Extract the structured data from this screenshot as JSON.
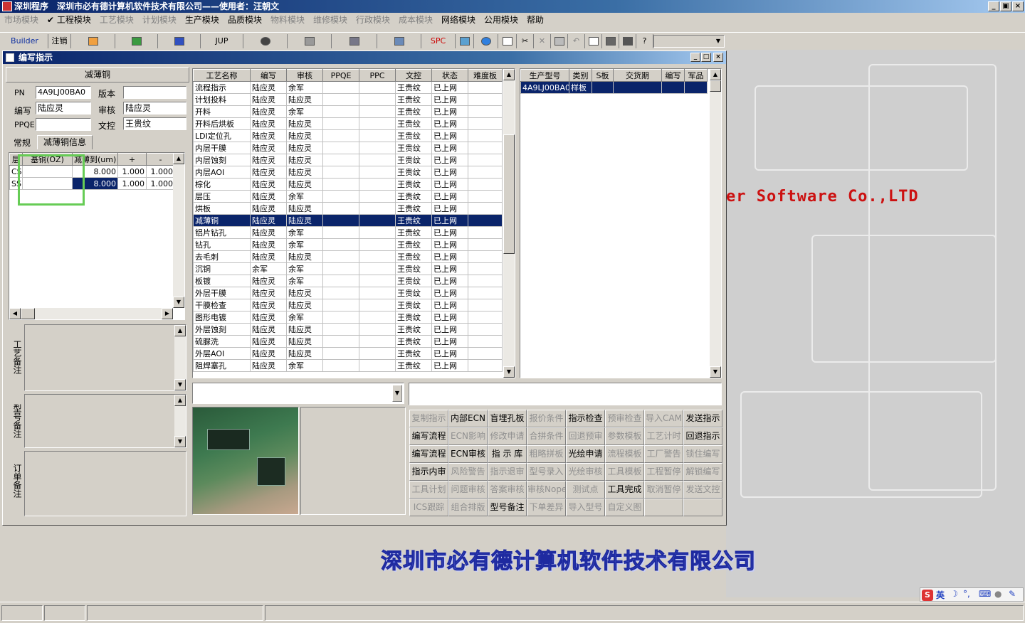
{
  "app": {
    "title": "深圳程序　深圳市必有德计算机软件技术有限公司——使用者：汪朝文",
    "minimize": "_",
    "restore": "▣",
    "close": "×"
  },
  "menu": [
    {
      "label": "市场模块",
      "enabled": false
    },
    {
      "label": "✔ 工程模块",
      "enabled": true
    },
    {
      "label": "工艺模块",
      "enabled": false
    },
    {
      "label": "计划模块",
      "enabled": false
    },
    {
      "label": "生产模块",
      "enabled": true
    },
    {
      "label": "品质模块",
      "enabled": true
    },
    {
      "label": "物料模块",
      "enabled": false
    },
    {
      "label": "维修模块",
      "enabled": false
    },
    {
      "label": "行政模块",
      "enabled": false
    },
    {
      "label": "成本模块",
      "enabled": false
    },
    {
      "label": "网络模块",
      "enabled": true
    },
    {
      "label": "公用模块",
      "enabled": true
    },
    {
      "label": "帮助",
      "enabled": true
    }
  ],
  "toolbar": {
    "builder": "Builder",
    "logout": "注销",
    "jup": "JUP",
    "spc": "SPC"
  },
  "background": {
    "company_en": "er Software Co.,LTD",
    "company_cn": "深圳市必有德计算机软件技术有限公司"
  },
  "window": {
    "title": "编写指示"
  },
  "left": {
    "header": "减薄铜",
    "pn_label": "PN",
    "pn_value": "4A9LJ00BA0",
    "version_label": "版本",
    "version_value": "",
    "writer_label": "编写",
    "writer_value": "陆应灵",
    "review_label": "审核",
    "review_value": "陆应灵",
    "ppqe_label": "PPQE",
    "ppqe_value": "",
    "docctl_label": "文控",
    "docctl_value": "王贵纹",
    "tabs": [
      "常规",
      "减薄铜信息"
    ],
    "thin_table": {
      "headers": [
        "层",
        "基铜(OZ)",
        "减薄到(um)",
        "+",
        "-"
      ],
      "rows": [
        [
          "CS",
          "",
          "8.000",
          "1.000",
          "1.000"
        ],
        [
          "SS",
          "",
          "8.000",
          "1.000",
          "1.000"
        ]
      ]
    },
    "remark_labels": [
      "工艺备注",
      "型号备注",
      "订单备注"
    ]
  },
  "process": {
    "headers": [
      "工艺名称",
      "编写",
      "审核",
      "PPQE",
      "PPC",
      "文控",
      "状态",
      "难度板"
    ],
    "rows": [
      [
        "流程指示",
        "陆应灵",
        "余军",
        "",
        "",
        "王贵纹",
        "已上网",
        ""
      ],
      [
        "计划投料",
        "陆应灵",
        "陆应灵",
        "",
        "",
        "王贵纹",
        "已上网",
        ""
      ],
      [
        "开料",
        "陆应灵",
        "余军",
        "",
        "",
        "王贵纹",
        "已上网",
        ""
      ],
      [
        "开料后烘板",
        "陆应灵",
        "陆应灵",
        "",
        "",
        "王贵纹",
        "已上网",
        ""
      ],
      [
        "LDI定位孔",
        "陆应灵",
        "陆应灵",
        "",
        "",
        "王贵纹",
        "已上网",
        ""
      ],
      [
        "内层干膜",
        "陆应灵",
        "陆应灵",
        "",
        "",
        "王贵纹",
        "已上网",
        ""
      ],
      [
        "内层蚀刻",
        "陆应灵",
        "陆应灵",
        "",
        "",
        "王贵纹",
        "已上网",
        ""
      ],
      [
        "内层AOI",
        "陆应灵",
        "陆应灵",
        "",
        "",
        "王贵纹",
        "已上网",
        ""
      ],
      [
        "棕化",
        "陆应灵",
        "陆应灵",
        "",
        "",
        "王贵纹",
        "已上网",
        ""
      ],
      [
        "层压",
        "陆应灵",
        "余军",
        "",
        "",
        "王贵纹",
        "已上网",
        ""
      ],
      [
        "烘板",
        "陆应灵",
        "陆应灵",
        "",
        "",
        "王贵纹",
        "已上网",
        ""
      ],
      [
        "减薄铜",
        "陆应灵",
        "陆应灵",
        "",
        "",
        "王贵纹",
        "已上网",
        ""
      ],
      [
        "铝片钻孔",
        "陆应灵",
        "余军",
        "",
        "",
        "王贵纹",
        "已上网",
        ""
      ],
      [
        "钻孔",
        "陆应灵",
        "余军",
        "",
        "",
        "王贵纹",
        "已上网",
        ""
      ],
      [
        "去毛刺",
        "陆应灵",
        "陆应灵",
        "",
        "",
        "王贵纹",
        "已上网",
        ""
      ],
      [
        "沉铜",
        "余军",
        "余军",
        "",
        "",
        "王贵纹",
        "已上网",
        ""
      ],
      [
        "板镀",
        "陆应灵",
        "余军",
        "",
        "",
        "王贵纹",
        "已上网",
        ""
      ],
      [
        "外层干膜",
        "陆应灵",
        "陆应灵",
        "",
        "",
        "王贵纹",
        "已上网",
        ""
      ],
      [
        "干膜检查",
        "陆应灵",
        "陆应灵",
        "",
        "",
        "王贵纹",
        "已上网",
        ""
      ],
      [
        "图形电镀",
        "陆应灵",
        "余军",
        "",
        "",
        "王贵纹",
        "已上网",
        ""
      ],
      [
        "外层蚀刻",
        "陆应灵",
        "陆应灵",
        "",
        "",
        "王贵纹",
        "已上网",
        ""
      ],
      [
        "硫脲洗",
        "陆应灵",
        "陆应灵",
        "",
        "",
        "王贵纹",
        "已上网",
        ""
      ],
      [
        "外层AOI",
        "陆应灵",
        "陆应灵",
        "",
        "",
        "王贵纹",
        "已上网",
        ""
      ],
      [
        "阻焊塞孔",
        "陆应灵",
        "余军",
        "",
        "",
        "王贵纹",
        "已上网",
        ""
      ]
    ],
    "selected_index": 11
  },
  "models": {
    "headers": [
      "生产型号",
      "类别",
      "S板",
      "交货期",
      "编写",
      "军品"
    ],
    "rows": [
      [
        "4A9LJ00BA0",
        "样板",
        "",
        "",
        "",
        ""
      ]
    ]
  },
  "buttons": [
    {
      "label": "复制指示",
      "enabled": false
    },
    {
      "label": "内部ECN",
      "enabled": true
    },
    {
      "label": "盲埋孔板",
      "enabled": true
    },
    {
      "label": "报价条件",
      "enabled": false
    },
    {
      "label": "指示检查",
      "enabled": true
    },
    {
      "label": "预审检查",
      "enabled": false
    },
    {
      "label": "导入CAM",
      "enabled": false
    },
    {
      "label": "发送指示",
      "enabled": true
    },
    {
      "label": "编写流程",
      "enabled": true
    },
    {
      "label": "ECN影响",
      "enabled": false
    },
    {
      "label": "修改申请",
      "enabled": false
    },
    {
      "label": "合拼条件",
      "enabled": false
    },
    {
      "label": "回退预审",
      "enabled": false
    },
    {
      "label": "参数模板",
      "enabled": false
    },
    {
      "label": "工艺计时",
      "enabled": false
    },
    {
      "label": "回退指示",
      "enabled": true
    },
    {
      "label": "编写流程",
      "enabled": true
    },
    {
      "label": "ECN审核",
      "enabled": true
    },
    {
      "label": "指 示 库",
      "enabled": true
    },
    {
      "label": "粗略拼板",
      "enabled": false
    },
    {
      "label": "光绘申请",
      "enabled": true
    },
    {
      "label": "流程模板",
      "enabled": false
    },
    {
      "label": "工厂警告",
      "enabled": false
    },
    {
      "label": "锁住编写",
      "enabled": false
    },
    {
      "label": "指示内审",
      "enabled": true
    },
    {
      "label": "风险警告",
      "enabled": false
    },
    {
      "label": "指示退审",
      "enabled": false
    },
    {
      "label": "型号录入",
      "enabled": false
    },
    {
      "label": "光绘审核",
      "enabled": false
    },
    {
      "label": "工具模板",
      "enabled": false
    },
    {
      "label": "工程暂停",
      "enabled": false
    },
    {
      "label": "解锁编写",
      "enabled": false
    },
    {
      "label": "工具计划",
      "enabled": false
    },
    {
      "label": "问题审核",
      "enabled": false
    },
    {
      "label": "答案审核",
      "enabled": false
    },
    {
      "label": "审核Nope",
      "enabled": false
    },
    {
      "label": "测试点",
      "enabled": false
    },
    {
      "label": "工具完成",
      "enabled": true
    },
    {
      "label": "取消暂停",
      "enabled": false
    },
    {
      "label": "发送文控",
      "enabled": false
    },
    {
      "label": "ICS跟踪",
      "enabled": false
    },
    {
      "label": "组合排版",
      "enabled": false
    },
    {
      "label": "型号备注",
      "enabled": true
    },
    {
      "label": "下单差异",
      "enabled": false
    },
    {
      "label": "导入型号",
      "enabled": false
    },
    {
      "label": "自定义图",
      "enabled": false
    },
    {
      "label": "",
      "enabled": false
    },
    {
      "label": "",
      "enabled": false
    }
  ],
  "tray": {
    "ime": "英"
  },
  "colors": {
    "selection": "#0a246a",
    "title_gradient_start": "#0a246a",
    "company_en": "#cc1111",
    "company_cn": "#5a6cd8",
    "highlight_box": "#66cc55"
  }
}
